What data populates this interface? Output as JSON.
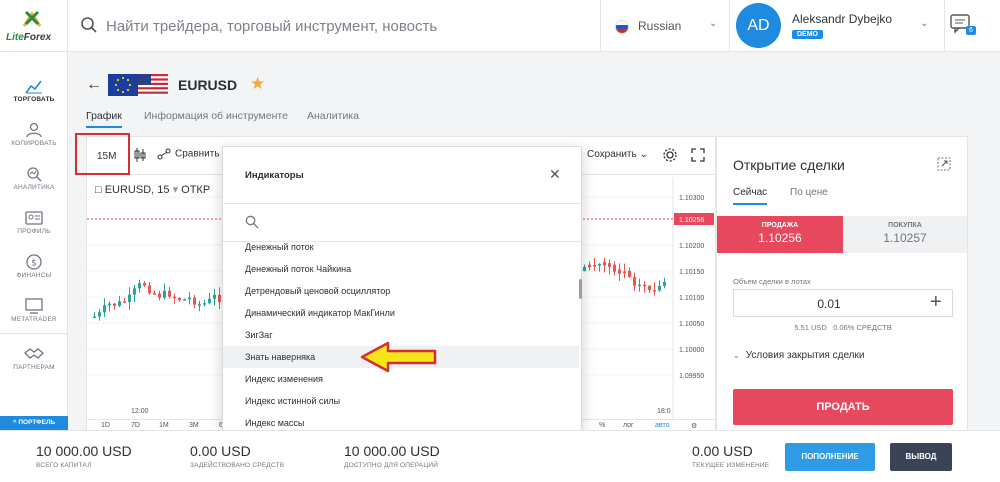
{
  "brand": {
    "name_part1": "Lite",
    "name_part2": "Forex"
  },
  "search": {
    "placeholder": "Найти трейдера, торговый инструмент, новость"
  },
  "language": {
    "label": "Russian"
  },
  "user": {
    "initials": "AD",
    "name": "Aleksandr Dybejko",
    "badge": "DEMO"
  },
  "notifications": {
    "count": "6"
  },
  "sidebar": {
    "items": [
      {
        "label": "ТОРГОВАТЬ",
        "icon": "chart-icon",
        "active": true
      },
      {
        "label": "КОПИРОВАТЬ",
        "icon": "copy-user-icon"
      },
      {
        "label": "АНАЛИТИКА",
        "icon": "analytics-icon"
      },
      {
        "label": "ПРОФИЛЬ",
        "icon": "profile-card-icon"
      },
      {
        "label": "ФИНАНСЫ",
        "icon": "dollar-icon"
      },
      {
        "label": "METATRADER",
        "icon": "monitor-icon"
      },
      {
        "label": "ПАРТНЕРАМ",
        "icon": "handshake-icon"
      }
    ],
    "portfolio": "^ ПОРТФЕЛЬ"
  },
  "instrument": {
    "symbol": "EURUSD"
  },
  "tabs": [
    {
      "label": "График",
      "active": true
    },
    {
      "label": "Информация об инструменте"
    },
    {
      "label": "Аналитика"
    }
  ],
  "chart_toolbar": {
    "timeframe": "15M",
    "compare": "Сравнить",
    "save": "Сохранить"
  },
  "chart": {
    "symbol_line": "EURUSD, 15",
    "symbol_extra": "ОТКР",
    "price_labels": [
      "1.10300",
      "1.10256",
      "1.10200",
      "1.10150",
      "1.10100",
      "1.10050",
      "1.10000",
      "1.09950"
    ],
    "current_price": "1.10256",
    "time_labels": [
      "12:00",
      "18:0"
    ],
    "timeframes": [
      "1D",
      "7D",
      "1M",
      "3M",
      "6"
    ],
    "right_controls": [
      "%",
      "лог",
      "авто"
    ]
  },
  "indicators_modal": {
    "title": "Индикаторы",
    "items": [
      "Денежный поток",
      "Денежный поток Чайкина",
      "Детрендовый ценовой осциллятор",
      "Динамический индикатор МакГинли",
      "ЗигЗаг",
      "Знать наверняка",
      "Индекс изменения",
      "Индекс истинной силы",
      "Индекс массы"
    ],
    "highlighted_index": 5
  },
  "order_panel": {
    "title": "Открытие сделки",
    "tabs": [
      {
        "label": "Сейчас",
        "active": true
      },
      {
        "label": "По цене"
      }
    ],
    "sell": {
      "label": "ПРОДАЖА",
      "price": "1.10256"
    },
    "buy": {
      "label": "ПОКУПКА",
      "price": "1.10257"
    },
    "volume_label": "Объем сделки в лотах",
    "volume": "0.01",
    "volume_usd": "5.51 USD",
    "volume_pct": "0.06% СРЕДСТВ",
    "conditions": "Условия закрытия сделки",
    "sell_button": "ПРОДАТЬ"
  },
  "footer": {
    "stats": [
      {
        "value": "10 000.00 USD",
        "label": "ВСЕГО КАПИТАЛ"
      },
      {
        "value": "0.00 USD",
        "label": "ЗАДЕЙСТВОВАНО СРЕДСТВ"
      },
      {
        "value": "10 000.00 USD",
        "label": "ДОСТУПНО ДЛЯ ОПЕРАЦИЙ"
      },
      {
        "value": "0.00 USD",
        "label": "ТЕКУЩЕЕ ИЗМЕНЕНИЕ"
      }
    ],
    "deposit": "ПОПОЛНЕНИЕ",
    "withdraw": "ВЫВОД"
  },
  "colors": {
    "accent": "#1e8be0",
    "sell": "#e8485d",
    "up": "#26a69a",
    "down": "#ef5350",
    "annotation": "#d32f2f",
    "arrow": "#f7e51a"
  }
}
